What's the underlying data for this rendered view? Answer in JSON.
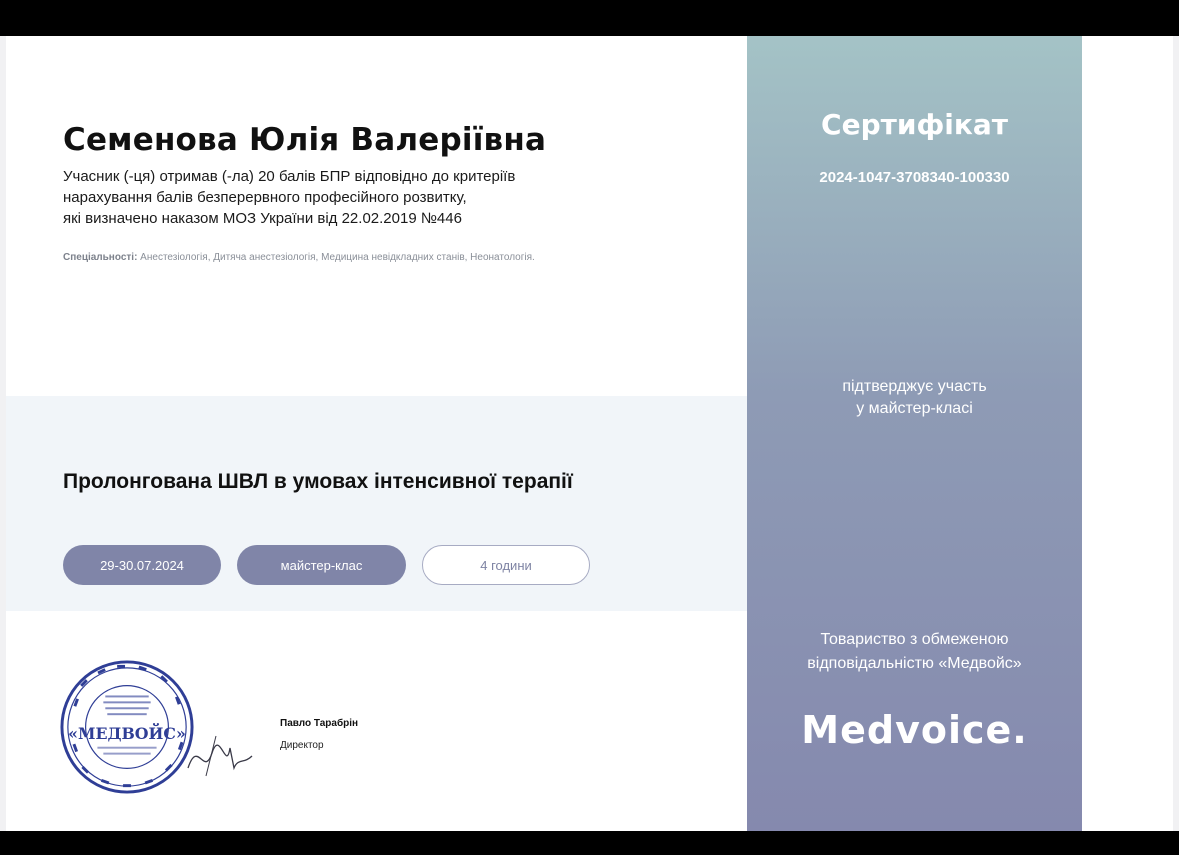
{
  "certificate": {
    "recipient_name": "Семенова Юлія Валеріївна",
    "description": [
      "Учасник (-ця) отримав (-ла) 20 балів БПР відповідно до критеріїв",
      "нарахування балів безперервного професійного розвитку,",
      "які визначено наказом МОЗ України від 22.02.2019 №446"
    ],
    "specialties_label": "Спеціальності:",
    "specialties_value": " Анестезіологія, Дитяча анестезіологія, Медицина невідкладних станів, Неонатологія.",
    "course_title": "Пролонгована ШВЛ в умовах інтенсивної терапії",
    "date": "29-30.07.2024",
    "format": "майстер-клас",
    "duration": "4 години",
    "signer_name": "Павло Тарабрін",
    "signer_role": "Директор",
    "seal_text": "«МЕДВОЙС»"
  },
  "panel": {
    "title": "Сертифікат",
    "number": "2024-1047-3708340-100330",
    "confirm_lines": [
      "підтверджує участь",
      "у майстер-класі"
    ],
    "org_lines": [
      "Товариство з обмеженою",
      "відповідальністю «Медвойс»"
    ],
    "brand": "Medvoice."
  },
  "colors": {
    "pill_fill": "#8085a8",
    "panel_top": "#a4c3c6",
    "panel_bottom": "#8589ae"
  }
}
